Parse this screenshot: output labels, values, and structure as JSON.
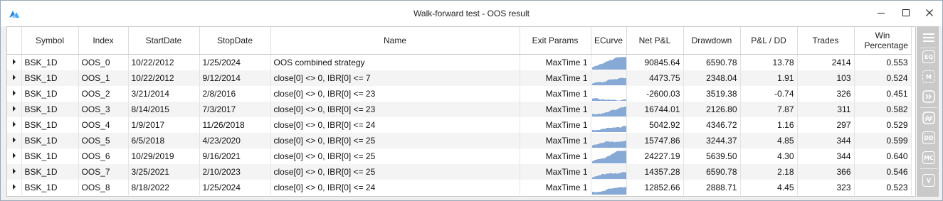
{
  "window": {
    "title": "Walk-forward test - OOS result"
  },
  "columns": [
    "Symbol",
    "Index",
    "StartDate",
    "StopDate",
    "Name",
    "Exit Params",
    "ECurve",
    "Net P&L",
    "Drawdown",
    "P&L / DD",
    "Trades",
    "Win Percentage"
  ],
  "rows": [
    {
      "symbol": "BSK_1D",
      "index": "OOS_0",
      "start": "10/22/2012",
      "stop": "1/25/2024",
      "name": "OOS combined strategy",
      "exit": "MaxTime 1",
      "pnl": "90845.64",
      "dd": "6590.78",
      "pnldd": "13.78",
      "trades": "2414",
      "win": "0.553"
    },
    {
      "symbol": "BSK_1D",
      "index": "OOS_1",
      "start": "10/22/2012",
      "stop": "9/12/2014",
      "name": "close[0] <> 0, IBR[0] <= 7",
      "exit": "MaxTime 1",
      "pnl": "4473.75",
      "dd": "2348.04",
      "pnldd": "1.91",
      "trades": "103",
      "win": "0.524"
    },
    {
      "symbol": "BSK_1D",
      "index": "OOS_2",
      "start": "3/21/2014",
      "stop": "2/8/2016",
      "name": "close[0] <> 0, IBR[0] <= 23",
      "exit": "MaxTime 1",
      "pnl": "-2600.03",
      "dd": "3519.38",
      "pnldd": "-0.74",
      "trades": "326",
      "win": "0.451"
    },
    {
      "symbol": "BSK_1D",
      "index": "OOS_3",
      "start": "8/14/2015",
      "stop": "7/3/2017",
      "name": "close[0] <> 0, IBR[0] <= 23",
      "exit": "MaxTime 1",
      "pnl": "16744.01",
      "dd": "2126.80",
      "pnldd": "7.87",
      "trades": "311",
      "win": "0.582"
    },
    {
      "symbol": "BSK_1D",
      "index": "OOS_4",
      "start": "1/9/2017",
      "stop": "11/26/2018",
      "name": "close[0] <> 0, IBR[0] <= 24",
      "exit": "MaxTime 1",
      "pnl": "5042.92",
      "dd": "4346.72",
      "pnldd": "1.16",
      "trades": "297",
      "win": "0.529"
    },
    {
      "symbol": "BSK_1D",
      "index": "OOS_5",
      "start": "6/5/2018",
      "stop": "4/23/2020",
      "name": "close[0] <> 0, IBR[0] <= 25",
      "exit": "MaxTime 1",
      "pnl": "15747.86",
      "dd": "3244.37",
      "pnldd": "4.85",
      "trades": "344",
      "win": "0.599"
    },
    {
      "symbol": "BSK_1D",
      "index": "OOS_6",
      "start": "10/29/2019",
      "stop": "9/16/2021",
      "name": "close[0] <> 0, IBR[0] <= 25",
      "exit": "MaxTime 1",
      "pnl": "24227.19",
      "dd": "5639.50",
      "pnldd": "4.30",
      "trades": "344",
      "win": "0.640"
    },
    {
      "symbol": "BSK_1D",
      "index": "OOS_7",
      "start": "3/25/2021",
      "stop": "2/10/2023",
      "name": "close[0] <> 0, IBR[0] <= 25",
      "exit": "MaxTime 1",
      "pnl": "14357.28",
      "dd": "6590.78",
      "pnldd": "2.18",
      "trades": "366",
      "win": "0.546"
    },
    {
      "symbol": "BSK_1D",
      "index": "OOS_8",
      "start": "8/18/2022",
      "stop": "1/25/2024",
      "name": "close[0] <> 0, IBR[0] <= 24",
      "exit": "MaxTime 1",
      "pnl": "12852.66",
      "dd": "2888.71",
      "pnldd": "4.45",
      "trades": "323",
      "win": "0.523"
    }
  ],
  "sidebar": {
    "badges": [
      "EQ",
      "M",
      "MC",
      "V",
      "DD"
    ]
  },
  "colors": {
    "curve_fill": "#86a9d6",
    "sidebar_bg": "#c9c9c9",
    "accent": "#1e88e5"
  }
}
